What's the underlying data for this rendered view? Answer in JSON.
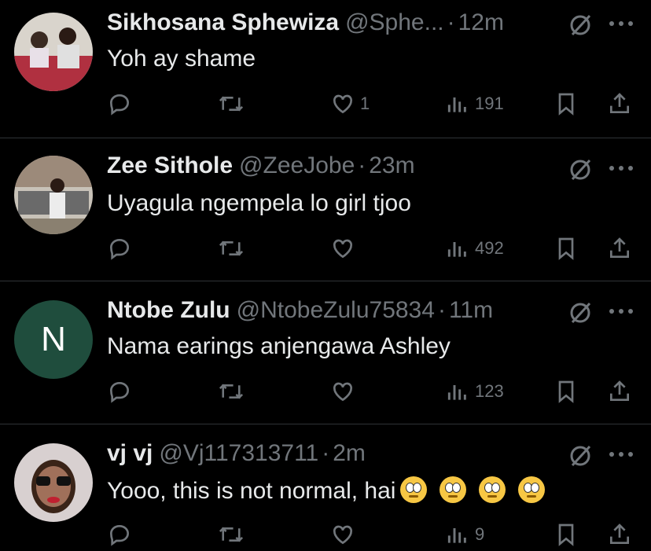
{
  "tweets": [
    {
      "name": "Sikhosana Sphewiza",
      "handle": "@Sphe...",
      "time": "12m",
      "text": "Yoh ay shame",
      "likes": "1",
      "views": "191",
      "avatar": "photo-couple"
    },
    {
      "name": "Zee Sithole",
      "handle": "@ZeeJobe",
      "time": "23m",
      "text": "Uyagula ngempela lo girl tjoo",
      "likes": "",
      "views": "492",
      "avatar": "photo-sofa"
    },
    {
      "name": "Ntobe Zulu",
      "handle": "@NtobeZulu75834",
      "time": "11m",
      "text": "Nama earings anjengawa Ashley",
      "likes": "",
      "views": "123",
      "avatar": "N"
    },
    {
      "name": "vj vj",
      "handle": "@Vj117313711",
      "time": "2m",
      "text": "Yooo, this is not normal, hai",
      "likes": "",
      "views": "9",
      "avatar": "photo-sunglasses",
      "emojis": [
        "face-with-rolling-eyes",
        "face-with-rolling-eyes",
        "face-with-rolling-eyes",
        "face-with-rolling-eyes"
      ]
    }
  ],
  "colors": {
    "background": "#000000",
    "text": "#e7e9ea",
    "muted": "#71767b",
    "divider": "#2f3336",
    "avatar_n_bg": "#1f4d3d"
  },
  "icons": [
    "grok-slash-icon",
    "more-icon",
    "reply-icon",
    "retweet-icon",
    "like-icon",
    "views-icon",
    "bookmark-icon",
    "share-icon"
  ]
}
